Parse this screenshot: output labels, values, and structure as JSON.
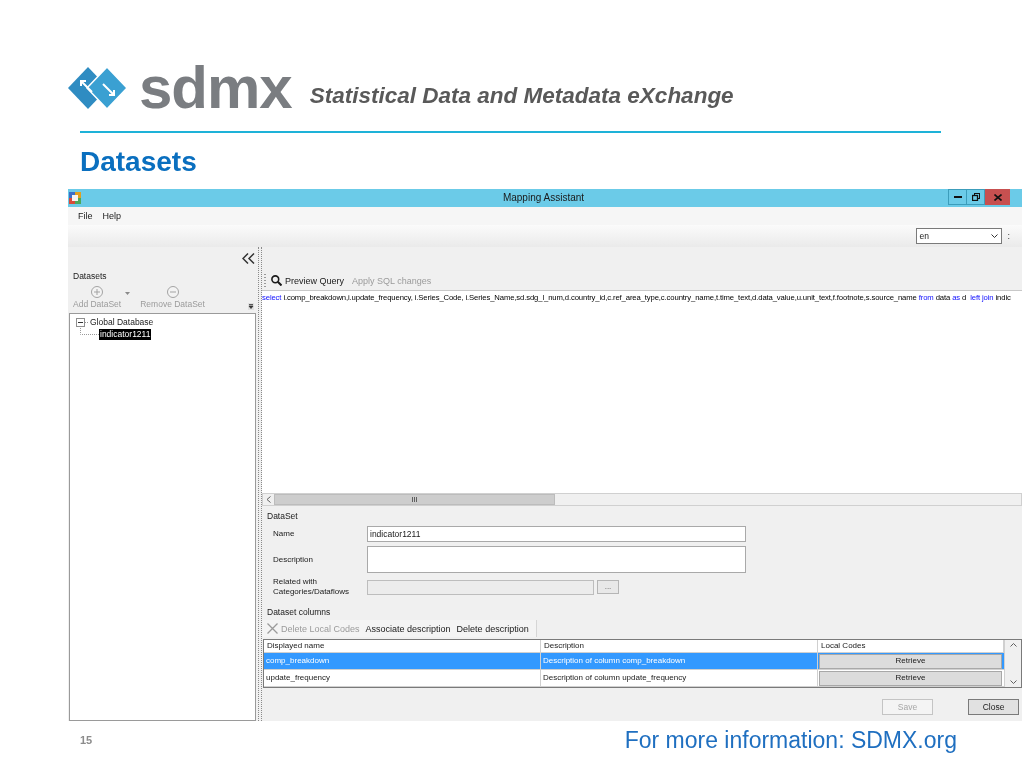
{
  "slide": {
    "logo": "sdmx",
    "tagline": "Statistical Data and Metadata eXchange",
    "title": "Datasets",
    "page_number": "15",
    "footer": "For more information: SDMX.org"
  },
  "window": {
    "title": "Mapping Assistant",
    "menu": [
      "File",
      "Help"
    ],
    "language": {
      "value": "en"
    },
    "language_suffix": ":"
  },
  "datasets_panel": {
    "label": "Datasets",
    "toolbar": [
      {
        "label": "Add DataSet",
        "kind": "add",
        "disabled": true,
        "dropdown": true
      },
      {
        "label": "Remove DataSet",
        "kind": "remove",
        "disabled": true,
        "dropdown": false
      }
    ],
    "tree": [
      {
        "label": "Global Database",
        "expanded": true,
        "selected": false,
        "children": [
          {
            "label": "indicator1211",
            "selected": true
          }
        ]
      }
    ]
  },
  "query": {
    "toolbar": [
      {
        "label": "Preview Query",
        "kind": "search",
        "disabled": false
      },
      {
        "label": "Apply SQL changes",
        "kind": "text",
        "disabled": true
      }
    ],
    "sql": [
      {
        "kind": "keyword",
        "text": "select"
      },
      {
        "kind": "plain",
        "text": " i.comp_breakdown,i.update_frequency, i.Series_Code, i.Series_Name,sd.sdg_l_num,d.country_id,c.ref_area_type,c.country_name,t.time_text,d.data_value,u.unit_text,f.footnote,s.source_name "
      },
      {
        "kind": "keyword",
        "text": "from"
      },
      {
        "kind": "plain",
        "text": " data "
      },
      {
        "kind": "keyword",
        "text": "as"
      },
      {
        "kind": "plain",
        "text": " d  "
      },
      {
        "kind": "keyword",
        "text": "left join"
      },
      {
        "kind": "plain",
        "text": " indic"
      }
    ]
  },
  "dataset": {
    "label": "DataSet",
    "fields": [
      {
        "kind": "text",
        "label": "Name",
        "value": "indicator1211",
        "disabled": false
      },
      {
        "kind": "textarea",
        "label": "Description",
        "disabled": false
      },
      {
        "kind": "picker",
        "label": "Related with\nCategories/Dataflows",
        "disabled": true,
        "button": "..."
      }
    ]
  },
  "columns": {
    "label": "Dataset columns",
    "toolbar": [
      {
        "label": "Delete Local Codes",
        "kind": "delete",
        "disabled": true
      },
      {
        "label": "Associate description",
        "kind": "text",
        "disabled": false
      },
      {
        "label": "Delete description",
        "kind": "text",
        "disabled": false
      }
    ],
    "table": {
      "columns": [
        "Displayed name",
        "Description",
        "Local Codes"
      ],
      "rows": [
        {
          "displayed_name": "comp_breakdown",
          "description": "Description of column comp_breakdown",
          "local_codes": "Retrieve",
          "selected": true
        },
        {
          "displayed_name": "update_frequency",
          "description": "Description of column update_frequency",
          "local_codes": "Retrieve",
          "selected": false
        }
      ]
    }
  },
  "actions": [
    {
      "label": "Save",
      "disabled": true
    },
    {
      "label": "Close",
      "disabled": false
    }
  ]
}
